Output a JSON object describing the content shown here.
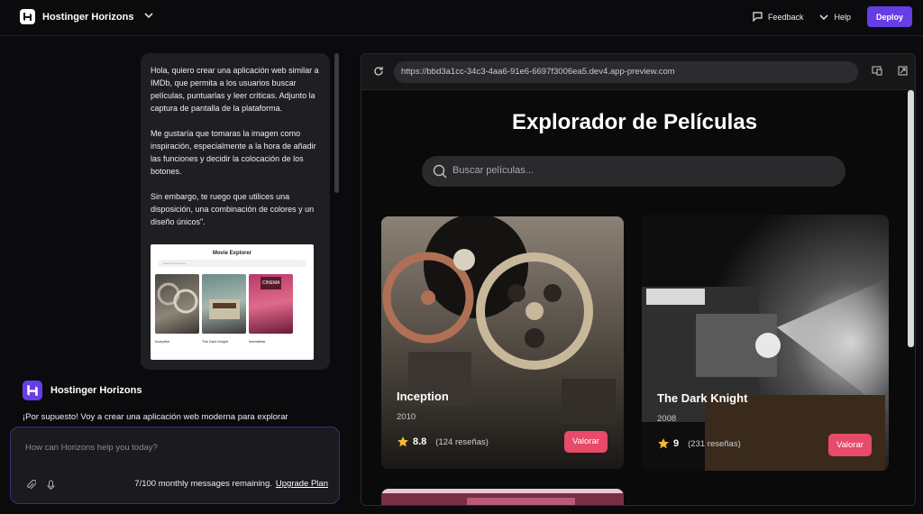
{
  "header": {
    "app_name": "Hostinger Horizons",
    "feedback_label": "Feedback",
    "help_label": "Help",
    "deploy_label": "Deploy",
    "accent": "#673de6"
  },
  "chat": {
    "user_message": [
      "Hola, quiero crear una aplicación web similar a IMDb, que permita a los usuarios buscar películas, puntuarlas y leer críticas. Adjunto la captura de pantalla de la plataforma.",
      "Me gustaría que tomaras la imagen como inspiración, especialmente a la hora de añadir las funciones y decidir la colocación de los botones.",
      "Sin embargo, te ruego que utilices una disposición, una combinación de colores y un diseño únicos\"."
    ],
    "attachment": {
      "title": "Movie Explorer",
      "search_placeholder": "Search for movies...",
      "cards": [
        "Inception",
        "The Dark Knight",
        "Interstellar"
      ],
      "third_poster_text": "CINEMA"
    },
    "agent_name": "Hostinger Horizons",
    "agent_reply": "¡Por supuesto! Voy a crear una aplicación web moderna para explorar"
  },
  "composer": {
    "placeholder": "How can Horizons help you today?",
    "quota": "7/100 monthly messages remaining.",
    "upgrade_label": "Upgrade Plan"
  },
  "preview": {
    "url": "https://bbd3a1cc-34c3-4aa6-91e6-6697f3006ea5.dev4.app-preview.com",
    "title": "Explorador de Películas",
    "search_placeholder": "Buscar películas...",
    "movies": [
      {
        "title": "Inception",
        "year": "2010",
        "rating": "8.8",
        "reviews": "(124 reseñas)",
        "button": "Valorar"
      },
      {
        "title": "The Dark Knight",
        "year": "2008",
        "rating": "9",
        "reviews": "(231 reseñas)",
        "button": "Valorar"
      }
    ],
    "button_color": "#e84a6a"
  }
}
